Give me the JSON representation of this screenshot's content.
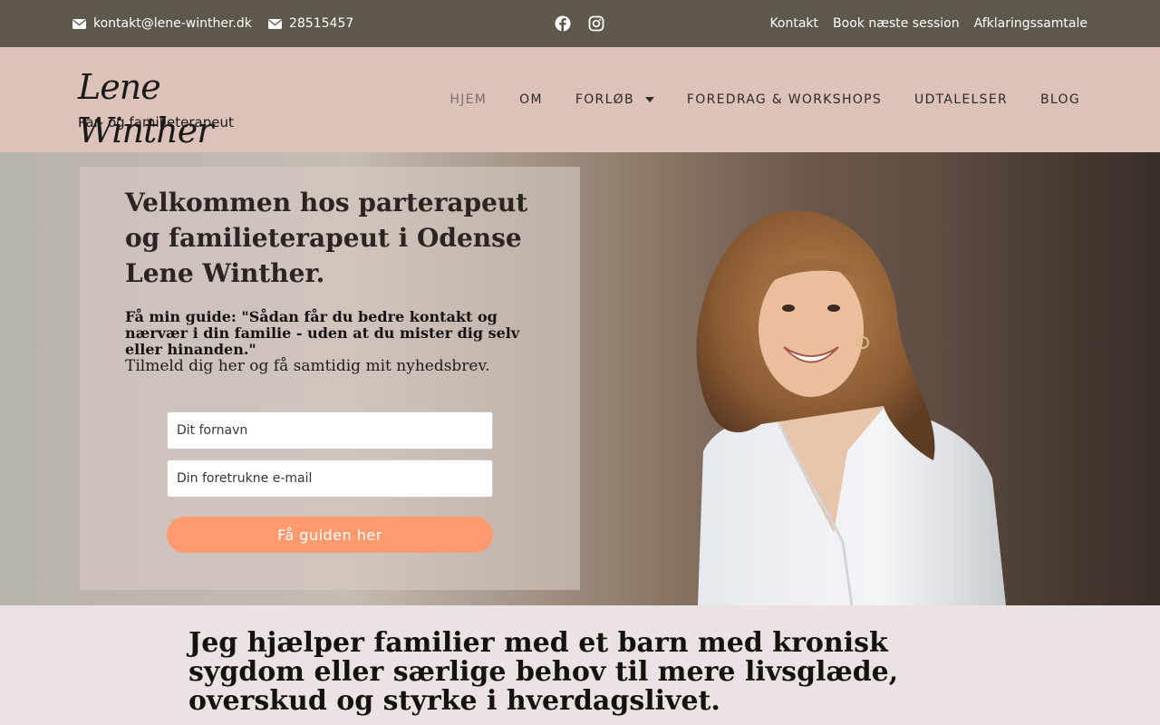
{
  "topbar": {
    "email": "kontakt@lene-winther.dk",
    "phone": "28515457",
    "social": [
      "facebook-icon",
      "instagram-icon"
    ],
    "links": [
      "Kontakt",
      "Book næste session",
      "Afklaringssamtale"
    ]
  },
  "header": {
    "logo_script": "Lene Winther",
    "logo_subtitle": "Par- og familieterapeut",
    "nav": [
      {
        "label": "HJEM",
        "active": true
      },
      {
        "label": "OM"
      },
      {
        "label": "FORLØB",
        "has_dropdown": true
      },
      {
        "label": "FOREDRAG & WORKSHOPS"
      },
      {
        "label": "UDTALELSER"
      },
      {
        "label": "BLOG"
      }
    ]
  },
  "hero": {
    "title": "Velkommen hos parterapeut og familieterapeut i Odense Lene Winther.",
    "guide": "Få min guide: \"Sådan får du bedre kontakt og nærvær i din familie - uden at du mister dig selv eller hinanden.\"",
    "subtitle": "Tilmeld dig her og få samtidig mit nyhedsbrev.",
    "form": {
      "name_placeholder": "Dit fornavn",
      "email_placeholder": "Din foretrukne e-mail",
      "button_label": "Få guiden her"
    }
  },
  "intro": {
    "text": "Jeg hjælper familier med et barn med kronisk sygdom eller særlige behov til mere livsglæde, overskud og styrke i hverdagslivet."
  },
  "colors": {
    "topbar_bg": "#5d584b",
    "header_bg": "#dcc2b8",
    "cta": "#ff9a6e",
    "page_bg": "#ebe3e3"
  }
}
